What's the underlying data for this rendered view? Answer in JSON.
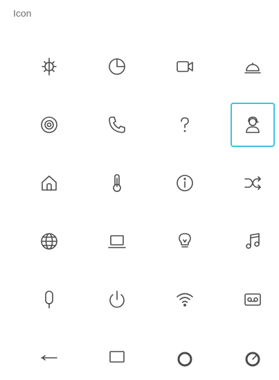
{
  "panel": {
    "title": "Icon"
  },
  "colors": {
    "accent": "#3cc3dc",
    "icon_stroke": "#4a4a4a"
  },
  "grid": {
    "columns": 4,
    "selected": "support-agent-icon",
    "icons": [
      "sun-icon",
      "pie-chart-icon",
      "video-camera-icon",
      "room-service-icon",
      "target-icon",
      "phone-icon",
      "question-icon",
      "support-agent-icon",
      "home-icon",
      "thermometer-icon",
      "info-icon",
      "shuffle-icon",
      "globe-icon",
      "laptop-icon",
      "lightbulb-icon",
      "music-note-icon",
      "microphone-icon",
      "power-icon",
      "wifi-icon",
      "voicemail-icon",
      "arrow-left-icon",
      "monitor-icon",
      "dial-icon",
      "gauge-icon"
    ]
  }
}
